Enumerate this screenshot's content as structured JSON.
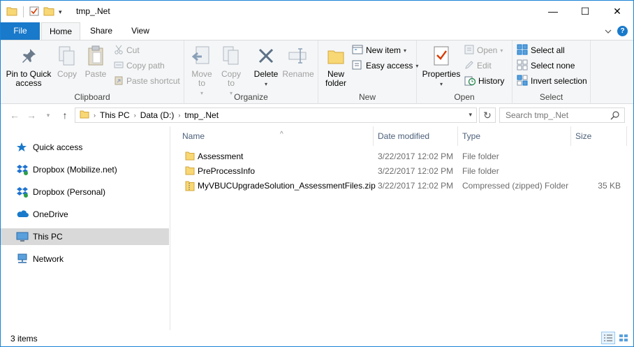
{
  "window": {
    "title": "tmp_.Net",
    "controls": {
      "minimize": "—",
      "maximize": "☐",
      "close": "✕"
    }
  },
  "quick_access_toolbar": {
    "dropdown": "▾"
  },
  "ribbon_tabs": {
    "file": "File",
    "home": "Home",
    "share": "Share",
    "view": "View"
  },
  "ribbon": {
    "clipboard": {
      "label": "Clipboard",
      "pin": "Pin to Quick access",
      "copy": "Copy",
      "paste": "Paste",
      "cut": "Cut",
      "copy_path": "Copy path",
      "paste_shortcut": "Paste shortcut"
    },
    "organize": {
      "label": "Organize",
      "move_to": "Move to",
      "copy_to": "Copy to",
      "delete": "Delete",
      "rename": "Rename"
    },
    "new": {
      "label": "New",
      "new_folder": "New folder",
      "new_item": "New item",
      "easy_access": "Easy access"
    },
    "open": {
      "label": "Open",
      "properties": "Properties",
      "open": "Open",
      "edit": "Edit",
      "history": "History"
    },
    "select": {
      "label": "Select",
      "select_all": "Select all",
      "select_none": "Select none",
      "invert_selection": "Invert selection"
    }
  },
  "address_bar": {
    "crumbs": [
      "This PC",
      "Data (D:)",
      "tmp_.Net"
    ],
    "search_placeholder": "Search tmp_.Net"
  },
  "nav_pane": {
    "items": [
      {
        "label": "Quick access",
        "icon": "star-icon"
      },
      {
        "label": "Dropbox (Mobilize.net)",
        "icon": "dropbox-icon"
      },
      {
        "label": "Dropbox (Personal)",
        "icon": "dropbox-icon"
      },
      {
        "label": "OneDrive",
        "icon": "cloud-icon"
      },
      {
        "label": "This PC",
        "icon": "computer-icon"
      },
      {
        "label": "Network",
        "icon": "network-icon"
      }
    ]
  },
  "file_list": {
    "columns": {
      "name": "Name",
      "date_modified": "Date modified",
      "type": "Type",
      "size": "Size"
    },
    "rows": [
      {
        "name": "Assessment",
        "date": "3/22/2017 12:02 PM",
        "type": "File folder",
        "size": ""
      },
      {
        "name": "PreProcessInfo",
        "date": "3/22/2017 12:02 PM",
        "type": "File folder",
        "size": ""
      },
      {
        "name": "MyVBUCUpgradeSolution_AssessmentFiles.zip",
        "date": "3/22/2017 12:02 PM",
        "type": "Compressed (zipped) Folder",
        "size": "35 KB"
      }
    ]
  },
  "status_bar": {
    "count": "3 items"
  },
  "colors": {
    "accent": "#1979ca",
    "selected_nav": "#d9d9d9",
    "folder": "#f8d775"
  }
}
